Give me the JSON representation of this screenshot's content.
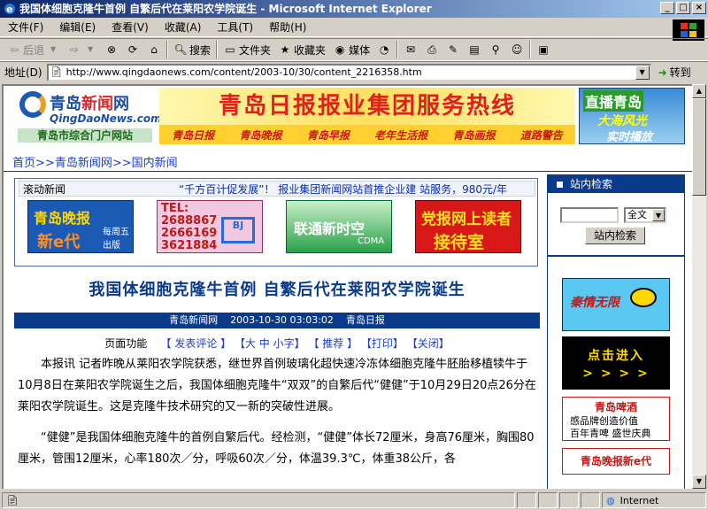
{
  "window": {
    "title": "我国体细胞克隆牛首例 自繁后代在莱阳农学院诞生 - Microsoft Internet Explorer",
    "min": "_",
    "max": "□",
    "close": "×"
  },
  "menu": [
    "文件(F)",
    "编辑(E)",
    "查看(V)",
    "收藏(A)",
    "工具(T)",
    "帮助(H)"
  ],
  "toolbar": {
    "back": "后退",
    "search": "搜索",
    "folders": "文件夹",
    "favorites": "收藏夹",
    "media": "媒体"
  },
  "address": {
    "label": "地址(D)",
    "url": "http://www.qingdaonews.com/content/2003-10/30/content_2216358.htm",
    "go": "转到"
  },
  "header": {
    "logo_main": "青岛",
    "logo_red": "新闻",
    "logo_tail": "网",
    "logo_url": "QingDaoNews.com",
    "logo_tagline": "青岛市综合门户网站",
    "banner": "青岛日报报业集团服务热线",
    "papers": [
      "青岛日报",
      "青岛晚报",
      "青岛早报",
      "老年生活报",
      "青岛画报",
      "道路警告"
    ],
    "live_a": "直播青岛",
    "live_b": "大海风光",
    "live_c": "实时播放"
  },
  "breadcrumb": [
    "首页",
    ">>",
    "青岛新闻网",
    ">>",
    "国内新闻"
  ],
  "news": {
    "scroll_label": "滚动新闻",
    "scroll_text": "“千方百计促发展”！  报业集团新闻网站首推企业建 站服务，980元/年"
  },
  "ads": {
    "ad1_a": "青岛晚报",
    "ad1_b": "新e代",
    "ad1_c": "每周五出版",
    "ad2_a": "TEL:\n2688867\n2666169\n3621884",
    "ad2_b": "BJ",
    "ad3_a": "联通新时空",
    "ad3_b": "CDMA",
    "ad4_a": "党报网上读者",
    "ad4_b": "接待室"
  },
  "article": {
    "title": "我国体细胞克隆牛首例  自繁后代在莱阳农学院诞生",
    "meta": "青岛新闻网    2003-10-30 03:03:02    青岛日报",
    "func_label": "页面功能",
    "funcs": [
      "【 发表评论 】",
      "【大 中 小字】",
      "【 推荐 】",
      "【打印】",
      "【关闭】"
    ],
    "paragraphs": [
      "本报讯 记者昨晚从莱阳农学院获悉，继世界首例玻璃化超快速冷冻体细胞克隆牛胚胎移植犊牛于10月8日在莱阳农学院诞生之后，我国体细胞克隆牛“双双”的自繁后代“健健”于10月29日20点26分在莱阳农学院诞生。这是克隆牛技术研究的又一新的突破性进展。",
      "“健健”是我国体细胞克隆牛的首例自繁后代。经检测，“健健”体长72厘米，身高76厘米，胸围80厘米，管围12厘米，心率180次／分，呼吸60次／分，体温39.3℃，体重38公斤，各"
    ]
  },
  "sidebar": {
    "search_title": "站内检索",
    "search_select": "全文",
    "search_button": "站内检索",
    "ad_a": "秦情无限",
    "ad_b": "点击进入\n> > > >",
    "ad_c_title": "青岛啤酒",
    "ad_c_1": "感品牌创造价值",
    "ad_c_2": "百年青啤 盛世庆典",
    "ad_d": "青岛晚报新e代"
  },
  "status": {
    "zone": "Internet"
  }
}
